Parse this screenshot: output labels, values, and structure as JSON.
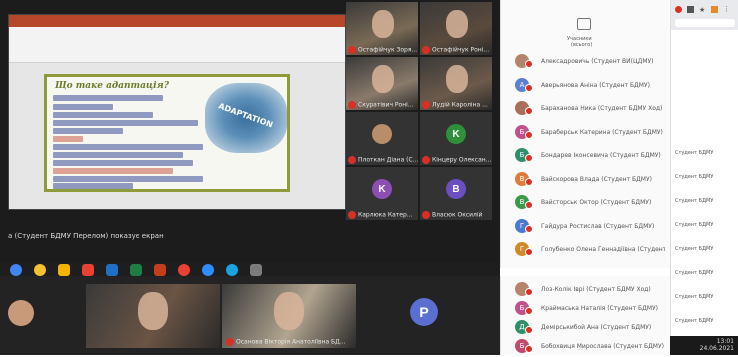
{
  "slide": {
    "title": "Що таке адаптація?",
    "wordcloud_label": "ADAPTATION"
  },
  "share_status": "а (Студент БДМУ Перелом) показує екран",
  "top_tiles": [
    {
      "name": "Остафійчук Зоря...",
      "type": "video",
      "color": "#7a6a55"
    },
    {
      "name": "Остафійчук Роні...",
      "type": "video",
      "color": "#5a4a3c"
    },
    {
      "name": "Скуратівич Роні...",
      "type": "video",
      "color": "#8a7a6a"
    },
    {
      "name": "Лудій Кароліна ...",
      "type": "video",
      "color": "#6c5a4a"
    },
    {
      "name": "Плоткан Діана (С...",
      "type": "photo",
      "color": "#b88e6a"
    },
    {
      "name": "Кінцеру Олексан...",
      "type": "letter",
      "letter": "K",
      "color": "#2f8f3a"
    },
    {
      "name": "Карлюка Катер...",
      "type": "letter",
      "letter": "K",
      "color": "#8e4fb5"
    },
    {
      "name": "Власюк Оксилій",
      "type": "letter",
      "letter": "B",
      "color": "#6b4fc2"
    }
  ],
  "participants_header": {
    "label": "Учасники",
    "sub": "(всього)"
  },
  "participants": [
    {
      "letter": "",
      "color": "#b5846a",
      "name": "Алексадровичь (Студент ВИ(ЦДМУ)"
    },
    {
      "letter": "А",
      "color": "#5b7fd1",
      "name": "Аверьянова Аніна (Студент БДМУ)"
    },
    {
      "letter": "",
      "color": "#a87058",
      "name": "Бараханова Ника (Студент БДМУ Ход)"
    },
    {
      "letter": "Б",
      "color": "#c2508a",
      "name": "Бараберськ Катерина (Студент БДМУ)"
    },
    {
      "letter": "Б",
      "color": "#2f8f6a",
      "name": "Бондарев Іконсевича (Студент БДМУ)"
    },
    {
      "letter": "В",
      "color": "#e07a3a",
      "name": "Вайскорова Влада (Студент БДМУ)"
    },
    {
      "letter": "В",
      "color": "#3a9a4a",
      "name": "Вайсторськ Октор (Студент БДМУ)"
    },
    {
      "letter": "Г",
      "color": "#4a7ad1",
      "name": "Гайдура Ростислав (Студент БДМУ)"
    },
    {
      "letter": "Г",
      "color": "#d18a2a",
      "name": "Голубенко Олена Геннадіївна (Студент БДМ...)"
    }
  ],
  "bottom_participants": [
    {
      "letter": "",
      "color": "#b5846a",
      "name": "Лоз-Колік Іврі (Студент БДМУ Ход)"
    },
    {
      "letter": "Б",
      "color": "#c2508a",
      "name": "Краймаська Наталія (Студент БДМУ)"
    },
    {
      "letter": "Д",
      "color": "#2f8f6a",
      "name": "Демірськибой Ана (Студент БДМУ)"
    },
    {
      "letter": "Б",
      "color": "#c24a6a",
      "name": "Бобохвиця Мирослава (Студент БДМУ)"
    }
  ],
  "bottom_tiles": [
    {
      "name": "",
      "type": "video",
      "color": "#6a5444"
    },
    {
      "name": "Осанова Вікторія Анатоліївна БД...",
      "type": "video",
      "color": "#b2a590"
    },
    {
      "name": "",
      "type": "letter",
      "letter": "P",
      "color": "#5b6fd1"
    }
  ],
  "browser": {
    "panel_items": [
      "Студент БДМУ",
      "Студент БДМУ",
      "Студент БДМУ",
      "Студент БДМУ",
      "Студент БДМУ",
      "Студент БДМУ",
      "Студент БДМУ",
      "Студент БДМУ",
      "Студент БДМУ"
    ]
  },
  "clock": {
    "time": "13:01",
    "date": "24.06.2021"
  }
}
